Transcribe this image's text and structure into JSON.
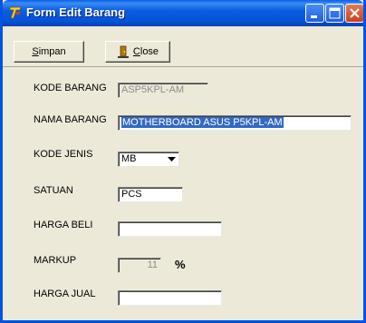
{
  "window": {
    "title": "Form Edit Barang"
  },
  "toolbar": {
    "save_label": "Simpan",
    "close_label": "Close"
  },
  "form": {
    "kode_barang": {
      "label": "KODE BARANG",
      "value": "ASP5KPL-AM"
    },
    "nama_barang": {
      "label": "NAMA BARANG",
      "value": "MOTHERBOARD ASUS P5KPL-AM"
    },
    "kode_jenis": {
      "label": "KODE JENIS",
      "value": "MB"
    },
    "satuan": {
      "label": "SATUAN",
      "value": "PCS"
    },
    "harga_beli": {
      "label": "HARGA BELI",
      "value": ""
    },
    "markup": {
      "label": "MARKUP",
      "value": "11",
      "unit": "%"
    },
    "harga_jual": {
      "label": "HARGA JUAL",
      "value": ""
    }
  }
}
